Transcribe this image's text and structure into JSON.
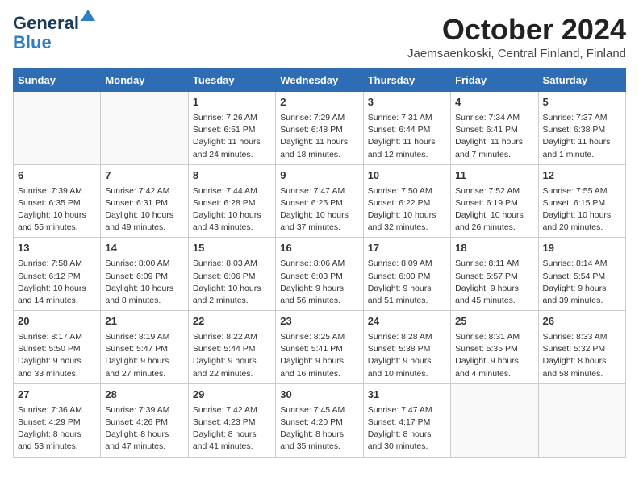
{
  "logo": {
    "line1": "General",
    "line2": "Blue"
  },
  "title": "October 2024",
  "location": "Jaemsaenkoski, Central Finland, Finland",
  "weekdays": [
    "Sunday",
    "Monday",
    "Tuesday",
    "Wednesday",
    "Thursday",
    "Friday",
    "Saturday"
  ],
  "weeks": [
    [
      {
        "day": "",
        "info": ""
      },
      {
        "day": "",
        "info": ""
      },
      {
        "day": "1",
        "info": "Sunrise: 7:26 AM\nSunset: 6:51 PM\nDaylight: 11 hours\nand 24 minutes."
      },
      {
        "day": "2",
        "info": "Sunrise: 7:29 AM\nSunset: 6:48 PM\nDaylight: 11 hours\nand 18 minutes."
      },
      {
        "day": "3",
        "info": "Sunrise: 7:31 AM\nSunset: 6:44 PM\nDaylight: 11 hours\nand 12 minutes."
      },
      {
        "day": "4",
        "info": "Sunrise: 7:34 AM\nSunset: 6:41 PM\nDaylight: 11 hours\nand 7 minutes."
      },
      {
        "day": "5",
        "info": "Sunrise: 7:37 AM\nSunset: 6:38 PM\nDaylight: 11 hours\nand 1 minute."
      }
    ],
    [
      {
        "day": "6",
        "info": "Sunrise: 7:39 AM\nSunset: 6:35 PM\nDaylight: 10 hours\nand 55 minutes."
      },
      {
        "day": "7",
        "info": "Sunrise: 7:42 AM\nSunset: 6:31 PM\nDaylight: 10 hours\nand 49 minutes."
      },
      {
        "day": "8",
        "info": "Sunrise: 7:44 AM\nSunset: 6:28 PM\nDaylight: 10 hours\nand 43 minutes."
      },
      {
        "day": "9",
        "info": "Sunrise: 7:47 AM\nSunset: 6:25 PM\nDaylight: 10 hours\nand 37 minutes."
      },
      {
        "day": "10",
        "info": "Sunrise: 7:50 AM\nSunset: 6:22 PM\nDaylight: 10 hours\nand 32 minutes."
      },
      {
        "day": "11",
        "info": "Sunrise: 7:52 AM\nSunset: 6:19 PM\nDaylight: 10 hours\nand 26 minutes."
      },
      {
        "day": "12",
        "info": "Sunrise: 7:55 AM\nSunset: 6:15 PM\nDaylight: 10 hours\nand 20 minutes."
      }
    ],
    [
      {
        "day": "13",
        "info": "Sunrise: 7:58 AM\nSunset: 6:12 PM\nDaylight: 10 hours\nand 14 minutes."
      },
      {
        "day": "14",
        "info": "Sunrise: 8:00 AM\nSunset: 6:09 PM\nDaylight: 10 hours\nand 8 minutes."
      },
      {
        "day": "15",
        "info": "Sunrise: 8:03 AM\nSunset: 6:06 PM\nDaylight: 10 hours\nand 2 minutes."
      },
      {
        "day": "16",
        "info": "Sunrise: 8:06 AM\nSunset: 6:03 PM\nDaylight: 9 hours\nand 56 minutes."
      },
      {
        "day": "17",
        "info": "Sunrise: 8:09 AM\nSunset: 6:00 PM\nDaylight: 9 hours\nand 51 minutes."
      },
      {
        "day": "18",
        "info": "Sunrise: 8:11 AM\nSunset: 5:57 PM\nDaylight: 9 hours\nand 45 minutes."
      },
      {
        "day": "19",
        "info": "Sunrise: 8:14 AM\nSunset: 5:54 PM\nDaylight: 9 hours\nand 39 minutes."
      }
    ],
    [
      {
        "day": "20",
        "info": "Sunrise: 8:17 AM\nSunset: 5:50 PM\nDaylight: 9 hours\nand 33 minutes."
      },
      {
        "day": "21",
        "info": "Sunrise: 8:19 AM\nSunset: 5:47 PM\nDaylight: 9 hours\nand 27 minutes."
      },
      {
        "day": "22",
        "info": "Sunrise: 8:22 AM\nSunset: 5:44 PM\nDaylight: 9 hours\nand 22 minutes."
      },
      {
        "day": "23",
        "info": "Sunrise: 8:25 AM\nSunset: 5:41 PM\nDaylight: 9 hours\nand 16 minutes."
      },
      {
        "day": "24",
        "info": "Sunrise: 8:28 AM\nSunset: 5:38 PM\nDaylight: 9 hours\nand 10 minutes."
      },
      {
        "day": "25",
        "info": "Sunrise: 8:31 AM\nSunset: 5:35 PM\nDaylight: 9 hours\nand 4 minutes."
      },
      {
        "day": "26",
        "info": "Sunrise: 8:33 AM\nSunset: 5:32 PM\nDaylight: 8 hours\nand 58 minutes."
      }
    ],
    [
      {
        "day": "27",
        "info": "Sunrise: 7:36 AM\nSunset: 4:29 PM\nDaylight: 8 hours\nand 53 minutes."
      },
      {
        "day": "28",
        "info": "Sunrise: 7:39 AM\nSunset: 4:26 PM\nDaylight: 8 hours\nand 47 minutes."
      },
      {
        "day": "29",
        "info": "Sunrise: 7:42 AM\nSunset: 4:23 PM\nDaylight: 8 hours\nand 41 minutes."
      },
      {
        "day": "30",
        "info": "Sunrise: 7:45 AM\nSunset: 4:20 PM\nDaylight: 8 hours\nand 35 minutes."
      },
      {
        "day": "31",
        "info": "Sunrise: 7:47 AM\nSunset: 4:17 PM\nDaylight: 8 hours\nand 30 minutes."
      },
      {
        "day": "",
        "info": ""
      },
      {
        "day": "",
        "info": ""
      }
    ]
  ]
}
